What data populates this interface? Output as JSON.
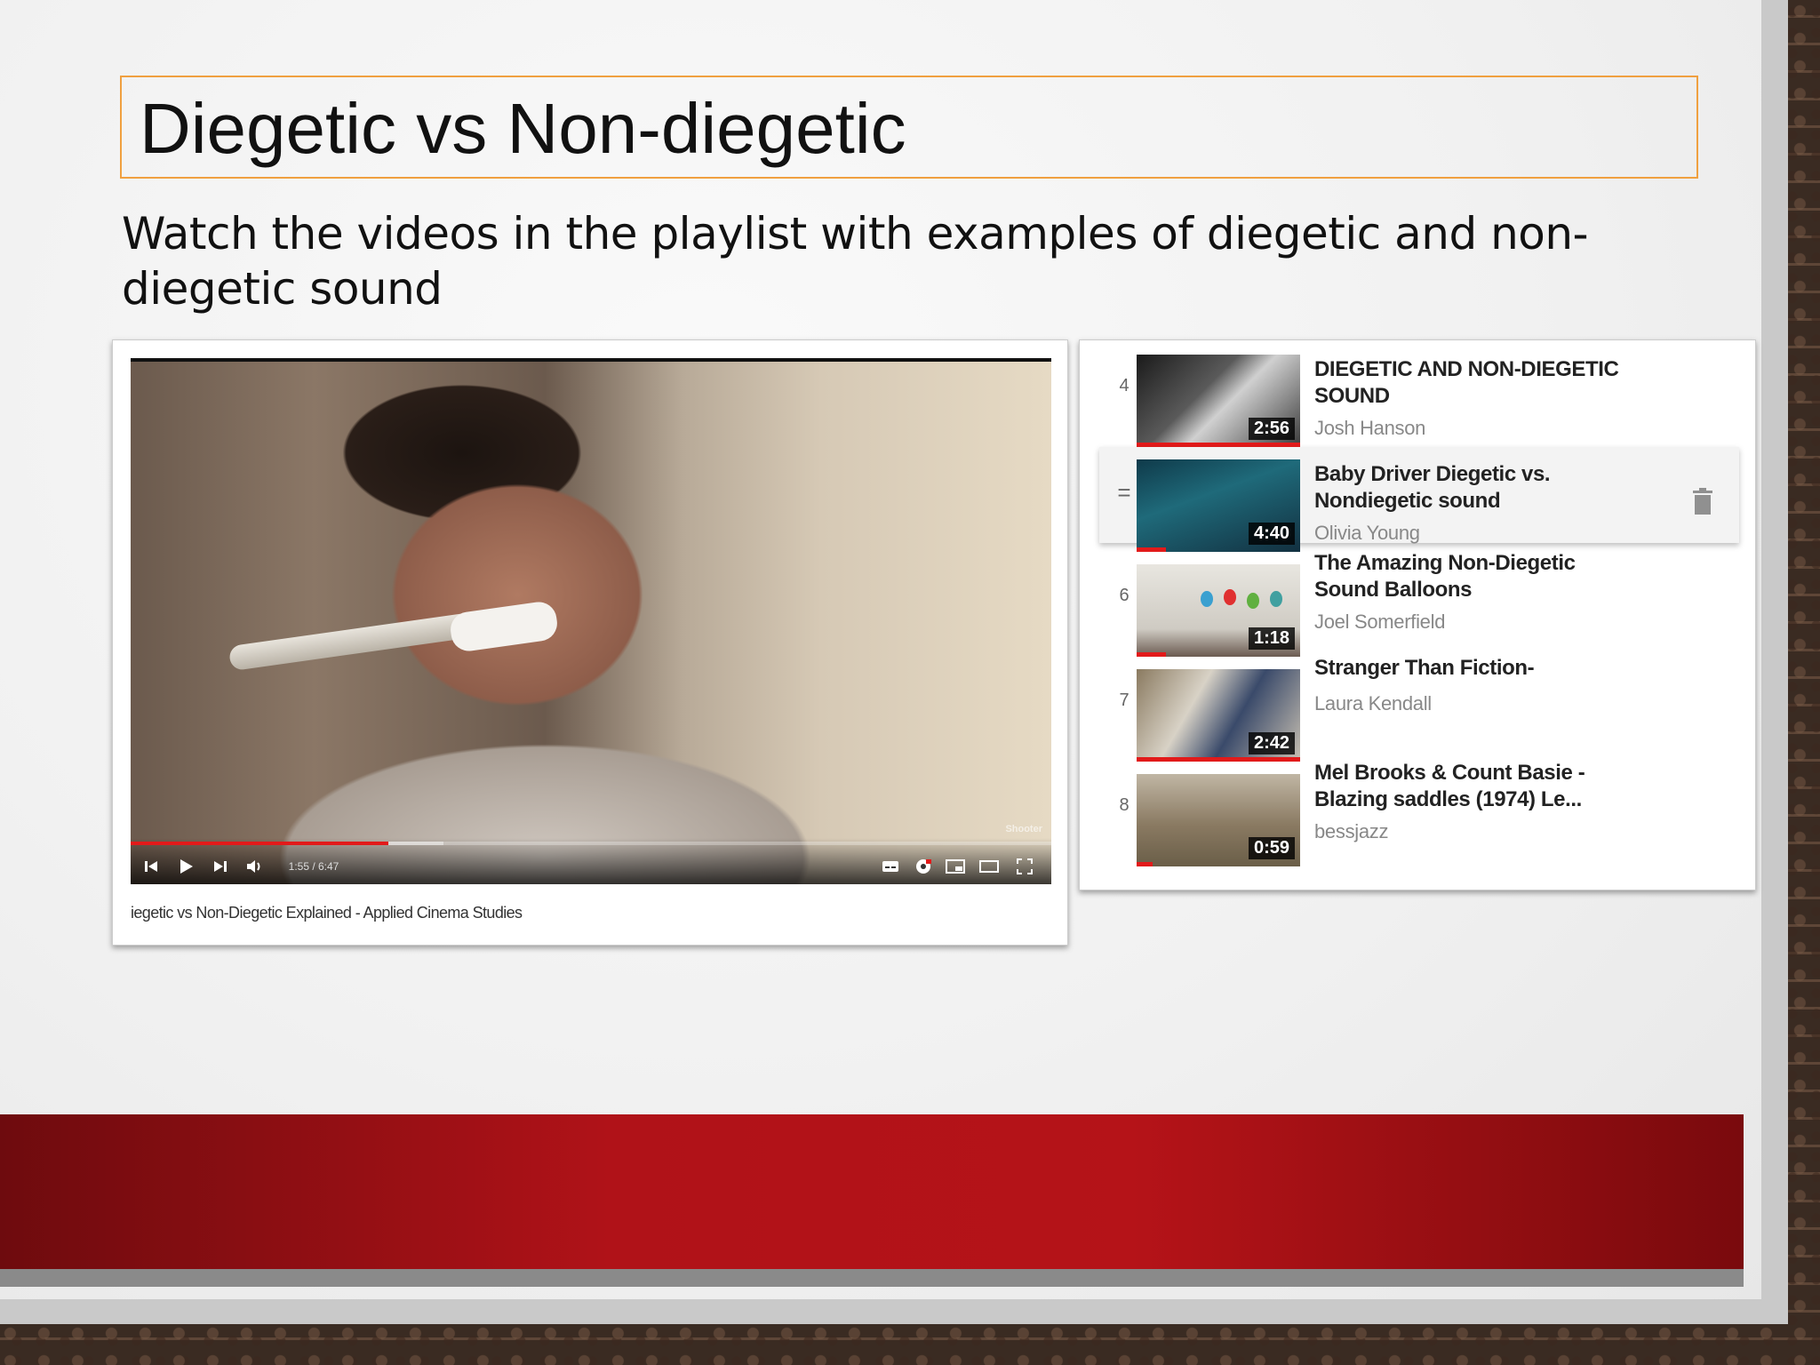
{
  "slide": {
    "title": "Diegetic vs Non-diegetic",
    "subtitle": "Watch the videos in the playlist with examples of diegetic and non-diegetic sound"
  },
  "player": {
    "time_display": "1:55 / 6:47",
    "watermark": "Shooter",
    "caption": "iegetic vs Non-Diegetic Explained - Applied Cinema Studies",
    "played_fraction": 0.28,
    "buffered_fraction": 0.34
  },
  "playlist": {
    "items": [
      {
        "index": "4",
        "title": "DIEGETIC AND NON-DIEGETIC SOUND",
        "channel": "Josh Hanson",
        "duration": "2:56",
        "watched_fraction": 1.0
      },
      {
        "index": "=",
        "title": "Baby Driver Diegetic vs. Nondiegetic sound",
        "channel": "Olivia Young",
        "duration": "4:40",
        "watched_fraction": 0.18
      },
      {
        "index": "6",
        "title": "The Amazing Non-Diegetic Sound Balloons",
        "channel": "Joel Somerfield",
        "duration": "1:18",
        "watched_fraction": 0.18
      },
      {
        "index": "7",
        "title": "Stranger Than Fiction-",
        "channel": "Laura Kendall",
        "duration": "2:42",
        "watched_fraction": 1.0
      },
      {
        "index": "8",
        "title": "Mel Brooks & Count Basie - Blazing saddles (1974) Le...",
        "channel": "bessjazz",
        "duration": "0:59",
        "watched_fraction": 0.1
      }
    ]
  },
  "colors": {
    "title_border": "#f0a040",
    "accent_red": "#e21a1a",
    "band_red": "#b01218"
  }
}
